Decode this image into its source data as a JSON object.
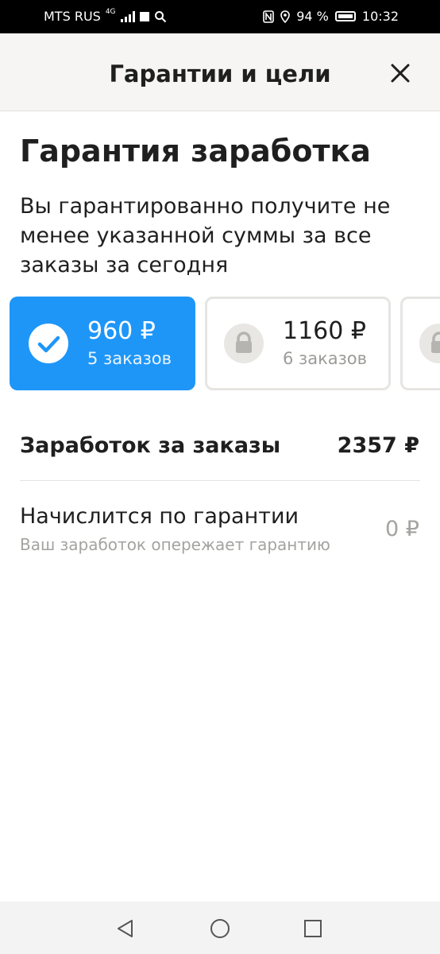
{
  "status_bar": {
    "carrier": "MTS RUS",
    "network": "4G",
    "battery": "94 %",
    "time": "10:32"
  },
  "header": {
    "title": "Гарантии и цели"
  },
  "guarantee": {
    "title": "Гарантия заработка",
    "description": "Вы гарантированно получите не менее указанной суммы за все заказы за сегодня",
    "options": [
      {
        "amount": "960 ₽",
        "orders": "5 заказов",
        "state": "selected"
      },
      {
        "amount": "1160 ₽",
        "orders": "6 заказов",
        "state": "locked"
      }
    ]
  },
  "earnings": {
    "orders_label": "Заработок за заказы",
    "orders_value": "2357 ₽",
    "accrual_label": "Начислится по гарантии",
    "accrual_note": "Ваш заработок опережает гарантию",
    "accrual_value": "0 ₽"
  },
  "colors": {
    "accent": "#1e96f8",
    "header_bg": "#f6f5f3",
    "muted_text": "#a3a3a0"
  },
  "icons": {
    "close": "close-icon",
    "selected": "check-icon",
    "locked": "lock-icon",
    "nav_back": "back-triangle-icon",
    "nav_home": "home-circle-icon",
    "nav_recent": "recent-square-icon"
  }
}
